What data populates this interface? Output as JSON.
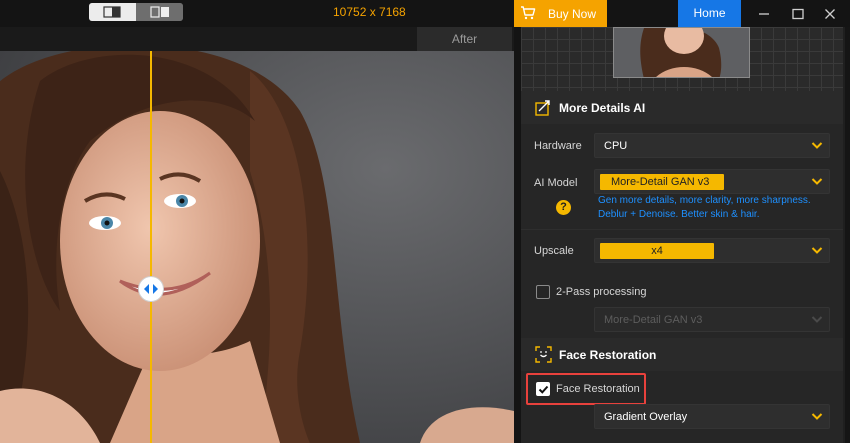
{
  "topbar": {
    "buy_label": "Buy Now",
    "home_label": "Home",
    "icons": [
      "cart-icon",
      "minimize-icon",
      "maximize-icon",
      "close-icon"
    ]
  },
  "viewer": {
    "resolution": "10752 x 7168",
    "after_label": "After",
    "view_modes": [
      "single-view",
      "split-view"
    ],
    "active_view_mode": "single-view"
  },
  "more_details": {
    "title": "More Details AI",
    "hardware_label": "Hardware",
    "hardware_value": "CPU",
    "ai_model_label": "AI Model",
    "ai_model_value": "More-Detail GAN  v3",
    "description_line1": "Gen more details, more clarity, more sharpness.",
    "description_line2": "Deblur + Denoise. Better skin & hair.",
    "help_symbol": "?",
    "upscale_label": "Upscale",
    "upscale_value": "x4",
    "two_pass_label": "2-Pass processing",
    "two_pass_checked": false,
    "two_pass_model": "More-Detail GAN  v3"
  },
  "face_restoration": {
    "title": "Face Restoration",
    "checkbox_label": "Face Restoration",
    "checked": true,
    "mode_value": "Gradient Overlay"
  },
  "colors": {
    "accent_orange": "#f5a300",
    "accent_yellow": "#f5b800",
    "home_blue": "#1677e6",
    "link_blue": "#1e90ff",
    "highlight_red": "#e8413c"
  }
}
